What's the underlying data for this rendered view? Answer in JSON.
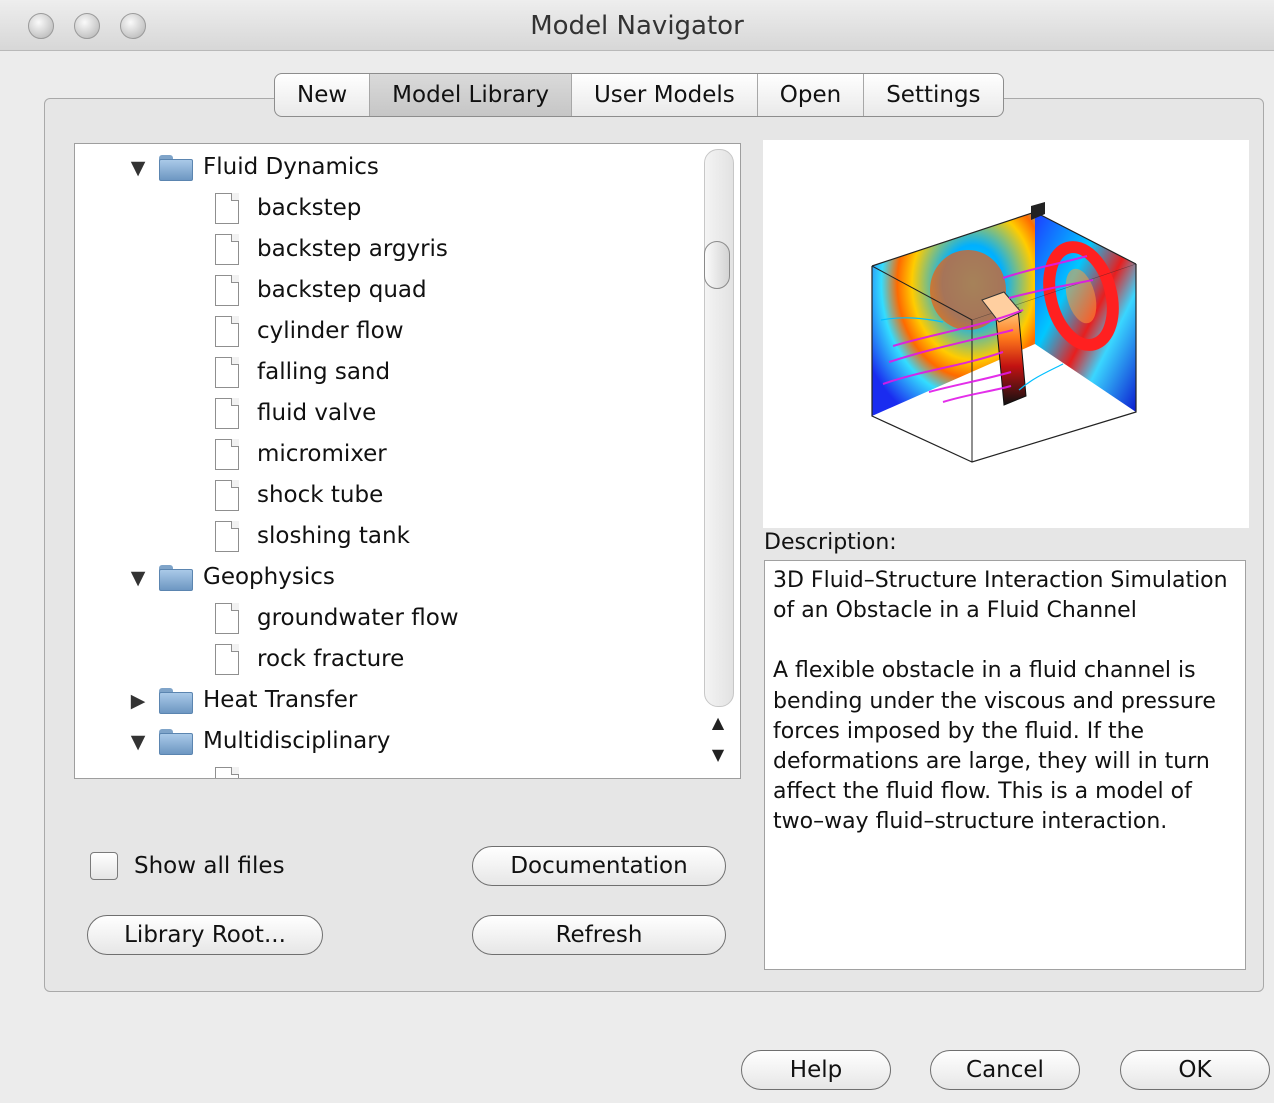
{
  "window": {
    "title": "Model Navigator"
  },
  "tabs": [
    {
      "label": "New"
    },
    {
      "label": "Model Library",
      "active": true
    },
    {
      "label": "User Models"
    },
    {
      "label": "Open"
    },
    {
      "label": "Settings"
    }
  ],
  "tree": {
    "rows": [
      {
        "type": "folder",
        "expanded": true,
        "label": "Fluid Dynamics"
      },
      {
        "type": "file",
        "label": "backstep"
      },
      {
        "type": "file",
        "label": "backstep argyris"
      },
      {
        "type": "file",
        "label": "backstep quad"
      },
      {
        "type": "file",
        "label": "cylinder flow"
      },
      {
        "type": "file",
        "label": "falling sand"
      },
      {
        "type": "file",
        "label": "fluid valve"
      },
      {
        "type": "file",
        "label": "micromixer"
      },
      {
        "type": "file",
        "label": "shock tube"
      },
      {
        "type": "file",
        "label": "sloshing tank"
      },
      {
        "type": "folder",
        "expanded": true,
        "label": "Geophysics"
      },
      {
        "type": "file",
        "label": "groundwater flow"
      },
      {
        "type": "file",
        "label": "rock fracture"
      },
      {
        "type": "folder",
        "expanded": false,
        "label": "Heat Transfer"
      },
      {
        "type": "folder",
        "expanded": true,
        "label": "Multidisciplinary"
      },
      {
        "type": "file",
        "label": ""
      }
    ]
  },
  "description": {
    "label": "Description:",
    "title": "3D Fluid–Structure Interaction Simulation of an Obstacle in a Fluid Channel",
    "body": "A flexible obstacle in a fluid channel is bending under the viscous and pressure forces imposed by the fluid. If the deformations are large, they will in turn affect the fluid flow. This is a model of two–way fluid–structure interaction."
  },
  "options": {
    "show_all_files_label": "Show all files",
    "show_all_files_checked": false
  },
  "buttons": {
    "documentation": "Documentation",
    "library_root": "Library Root...",
    "refresh": "Refresh",
    "help": "Help",
    "cancel": "Cancel",
    "ok": "OK"
  },
  "icons": {
    "disclosure_expanded": "triangle-down-icon",
    "disclosure_collapsed": "triangle-right-icon",
    "folder": "folder-icon",
    "file": "document-icon",
    "scroll_up": "scroll-up-arrow-icon",
    "scroll_down": "scroll-down-arrow-icon"
  }
}
